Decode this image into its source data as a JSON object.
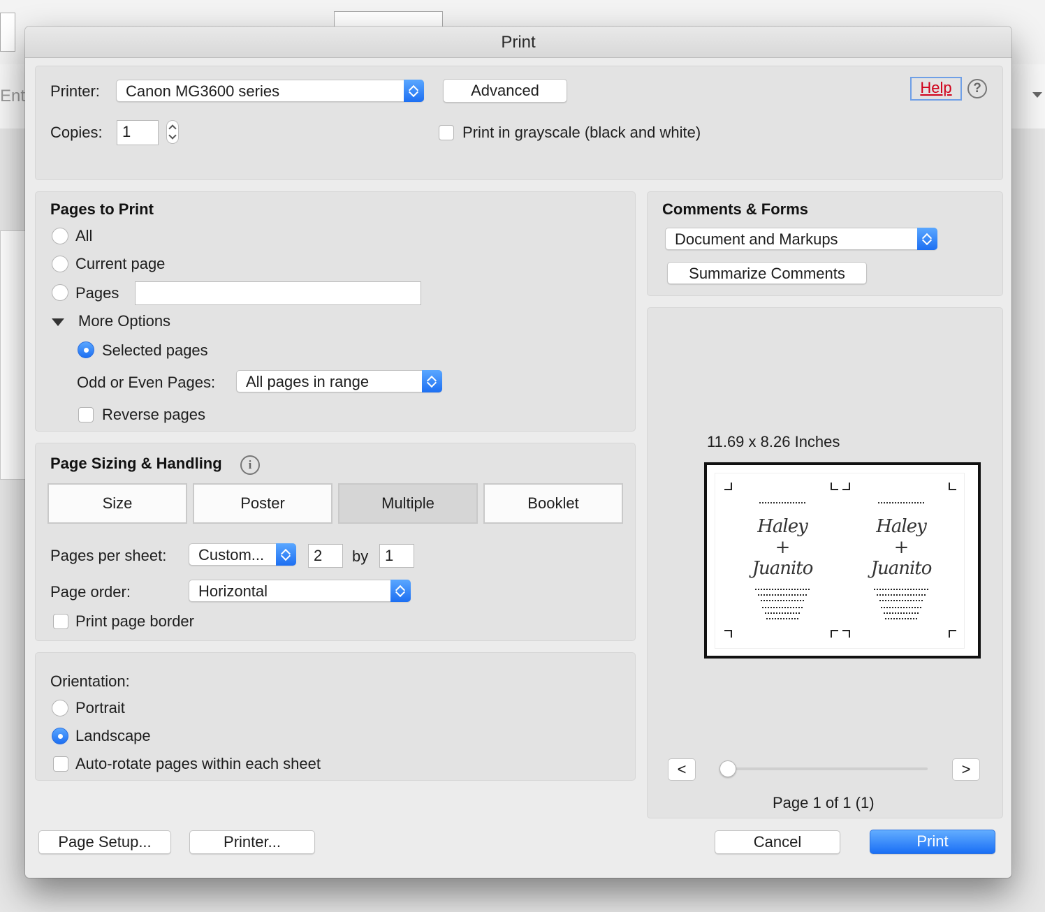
{
  "background": {
    "partial_text": "Ent"
  },
  "dialog": {
    "title": "Print",
    "printer": {
      "label": "Printer:",
      "selected": "Canon MG3600 series",
      "advanced_label": "Advanced"
    },
    "copies": {
      "label": "Copies:",
      "value": "1"
    },
    "grayscale_label": "Print in grayscale (black and white)",
    "help_label": "Help",
    "help_icon": "?",
    "pages_to_print": {
      "title": "Pages to Print",
      "options": [
        "All",
        "Current page",
        "Pages"
      ],
      "pages_value": "",
      "more_options_label": "More Options",
      "selected_pages_label": "Selected pages",
      "odd_even_label": "Odd or Even Pages:",
      "odd_even_value": "All pages in range",
      "reverse_label": "Reverse pages"
    },
    "sizing": {
      "title": "Page Sizing & Handling",
      "info_icon": "i",
      "tabs": [
        "Size",
        "Poster",
        "Multiple",
        "Booklet"
      ],
      "selected_tab": "Multiple",
      "pages_per_sheet_label": "Pages per sheet:",
      "pages_per_sheet_value": "Custom...",
      "grid_cols": "2",
      "by_label": "by",
      "grid_rows": "1",
      "page_order_label": "Page order:",
      "page_order_value": "Horizontal",
      "border_label": "Print page border"
    },
    "orientation": {
      "title": "Orientation:",
      "portrait_label": "Portrait",
      "landscape_label": "Landscape",
      "selected": "Landscape",
      "autorotate_label": "Auto-rotate pages within each sheet"
    },
    "comments_forms": {
      "title": "Comments & Forms",
      "value": "Document and Markups",
      "summarize_label": "Summarize Comments"
    },
    "preview": {
      "size_label": "11.69 x 8.26 Inches",
      "invite_text": "Haley + Juanito",
      "prev_label": "<",
      "next_label": ">",
      "page_status": "Page 1 of 1 (1)"
    },
    "footer": {
      "page_setup_label": "Page Setup...",
      "printer_label": "Printer...",
      "cancel_label": "Cancel",
      "print_label": "Print"
    }
  },
  "colors": {
    "accent": "#1d6ff2",
    "help_link": "#d0021b"
  }
}
